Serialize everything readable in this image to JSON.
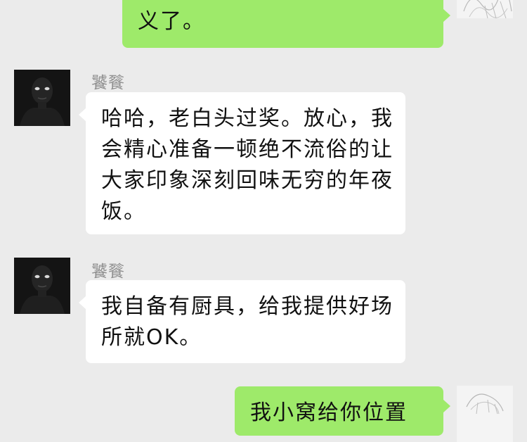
{
  "chat": {
    "messages": [
      {
        "id": "m1",
        "side": "right",
        "sender": "",
        "text": "义了。"
      },
      {
        "id": "m2",
        "side": "left",
        "sender": "饕餮",
        "text": "哈哈，老白头过奖。放心，我\n会精心准备一顿绝不流俗的让\n大家印象深刻回味无穷的年夜\n饭。"
      },
      {
        "id": "m3",
        "side": "left",
        "sender": "饕餮",
        "text": "我自备有厨具，给我提供好场\n所就OK。"
      },
      {
        "id": "m4",
        "side": "right",
        "sender": "",
        "text": "我小窝给你位置"
      }
    ]
  },
  "colors": {
    "background": "#ebebeb",
    "outgoing_bubble": "#9eea6a",
    "incoming_bubble": "#ffffff",
    "sender_name": "#8f8f8f"
  },
  "icons": {
    "incoming_avatar": "dark-masked-figure-avatar",
    "outgoing_avatar": "sketch-figure-avatar"
  }
}
